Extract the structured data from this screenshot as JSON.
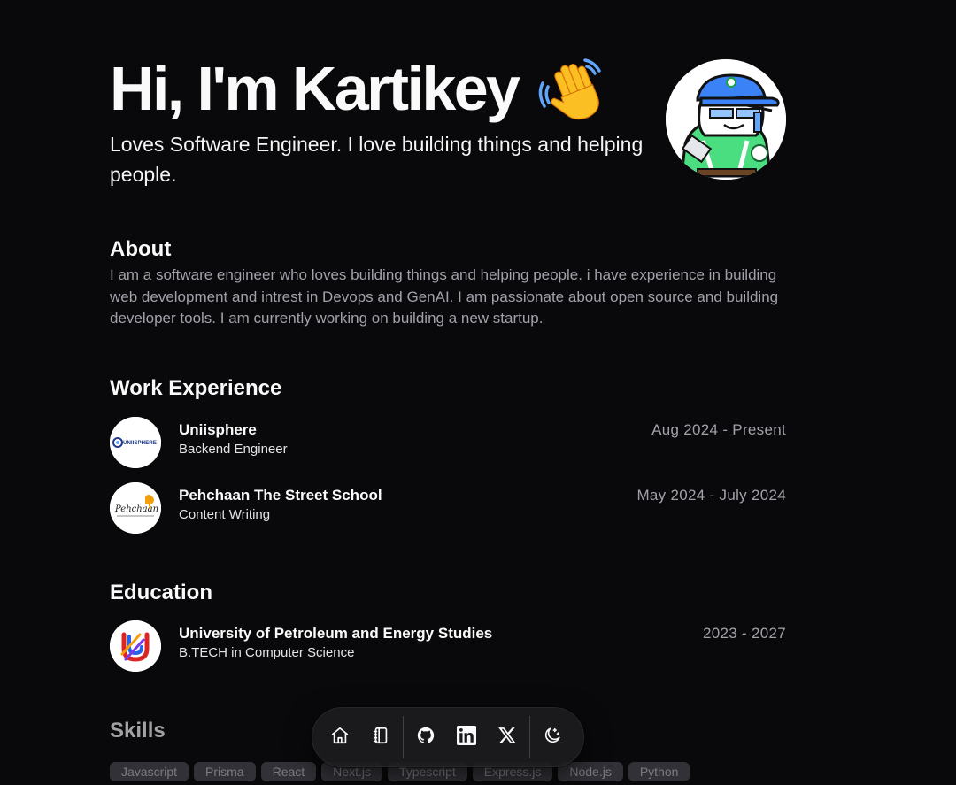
{
  "hero": {
    "title": "Hi, I'm Kartikey",
    "subtitle": "Loves Software Engineer. I love building things and helping people."
  },
  "about": {
    "title": "About",
    "text": "I am a software engineer who loves building things and helping people. i have experience in building web development and intrest in Devops and GenAI. I am passionate about open source and building developer tools. I am currently working on building a new startup."
  },
  "work": {
    "title": "Work Experience",
    "items": [
      {
        "name": "Uniisphere",
        "role": "Backend Engineer",
        "date": "Aug 2024 - Present",
        "logo_text": "UNIISPHERE"
      },
      {
        "name": "Pehchaan The Street School",
        "role": "Content Writing",
        "date": "May 2024 - July 2024",
        "logo_text": "Pehchaan"
      }
    ]
  },
  "education": {
    "title": "Education",
    "items": [
      {
        "name": "University of Petroleum and Energy Studies",
        "role": "B.TECH in Computer Science",
        "date": "2023 - 2027"
      }
    ]
  },
  "skills": {
    "title": "Skills",
    "items": [
      "Javascript",
      "Prisma",
      "React",
      "Next.js",
      "Typescript",
      "Express.js",
      "Node.js",
      "Python"
    ]
  },
  "dock": {
    "icons": [
      "home-icon",
      "notebook-icon",
      "github-icon",
      "linkedin-icon",
      "x-icon",
      "theme-toggle-icon"
    ]
  },
  "colors": {
    "background": "#09090b",
    "muted_text": "#a1a1aa",
    "badge_bg": "#3f3f46"
  }
}
